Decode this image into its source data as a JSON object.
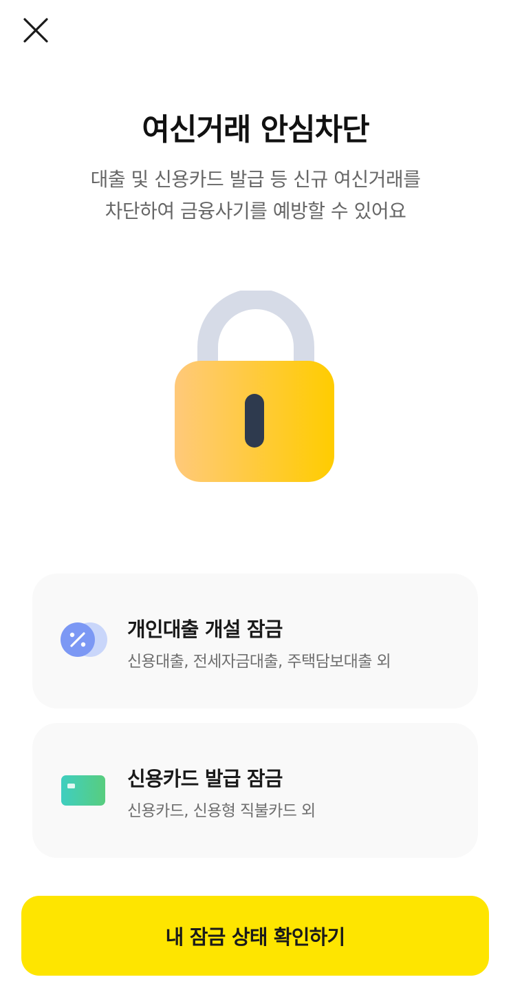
{
  "header": {
    "close_icon": "close-icon"
  },
  "hero": {
    "title": "여신거래 안심차단",
    "description_line1": "대출 및 신용카드 발급 등 신규 여신거래를",
    "description_line2": "차단하여 금융사기를 예방할 수 있어요",
    "illustration_icon": "padlock-icon"
  },
  "options": [
    {
      "icon": "loan-percent-icon",
      "title": "개인대출 개설 잠금",
      "subtitle": "신용대출, 전세자금대출, 주택담보대출 외"
    },
    {
      "icon": "credit-card-icon",
      "title": "신용카드 발급 잠금",
      "subtitle": "신용카드, 신용형 직불카드 외"
    }
  ],
  "cta": {
    "label": "내 잠금 상태 확인하기"
  },
  "colors": {
    "cta_background": "#FEE500",
    "card_background": "#F9F9F9",
    "lock_body_start": "#FFC97A",
    "lock_body_end": "#FFCC00",
    "lock_shackle": "#D6DBE7",
    "keyhole": "#2E3A4E"
  }
}
